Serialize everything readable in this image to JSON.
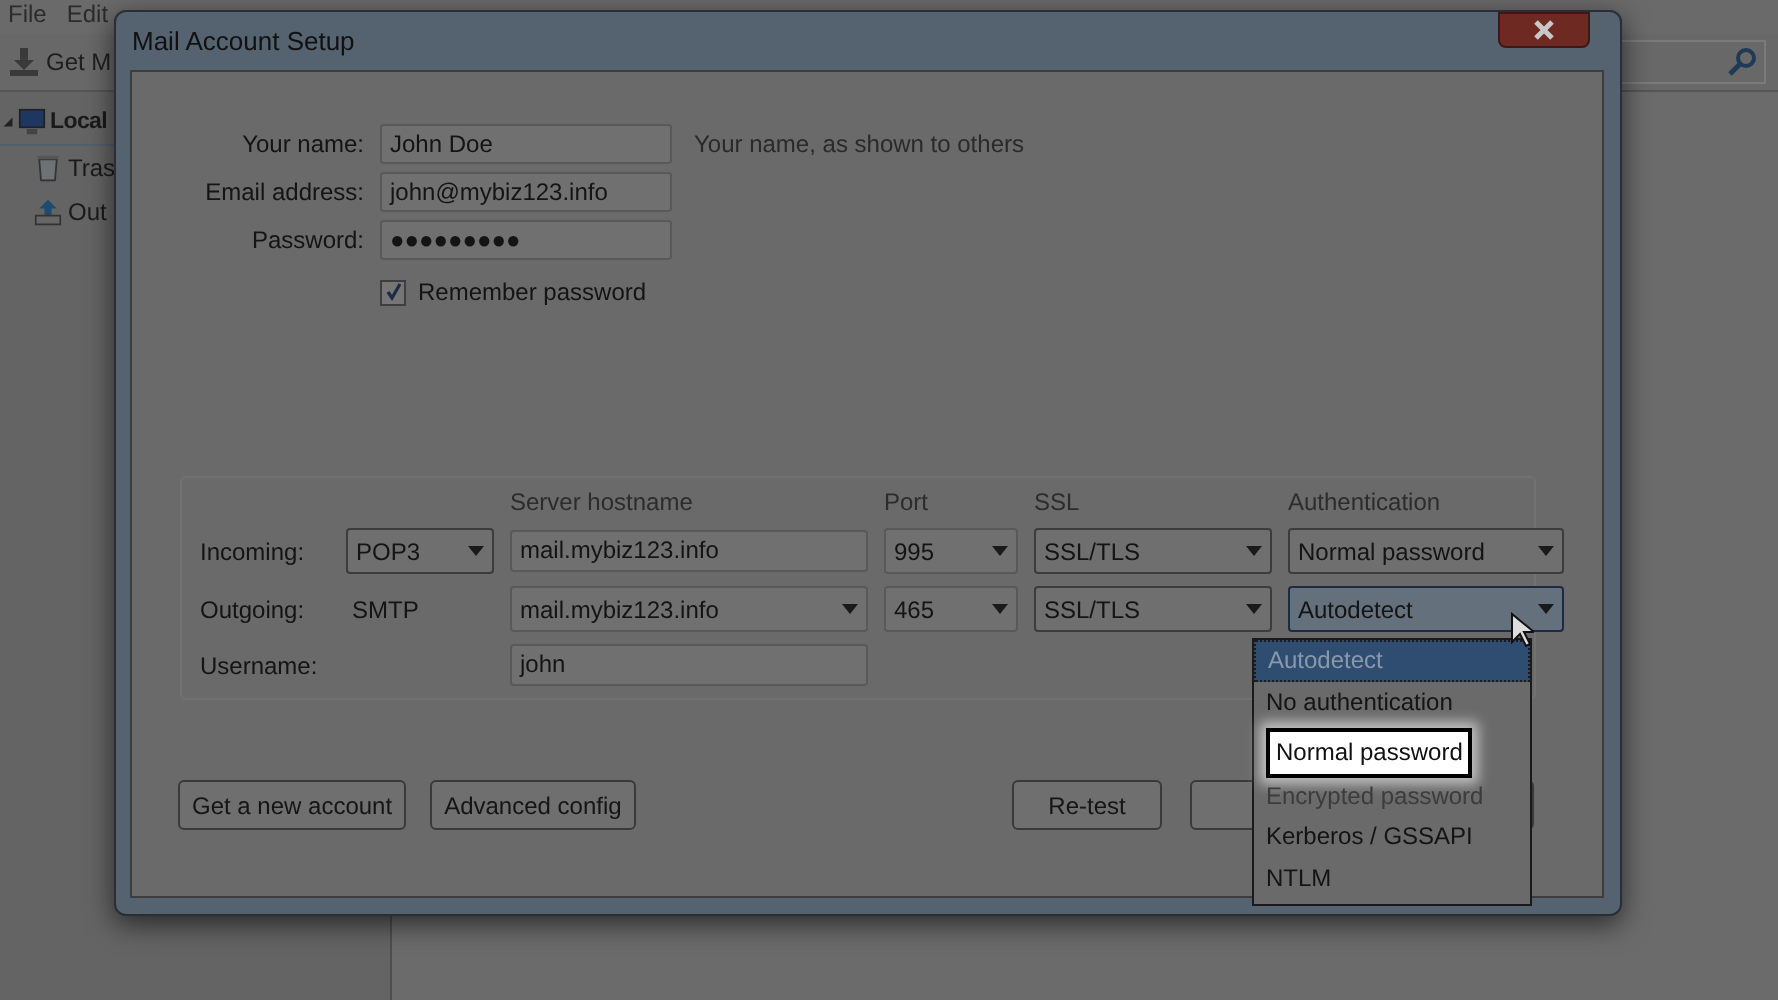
{
  "background_app": {
    "menu": [
      "File",
      "Edit"
    ],
    "toolbar_button": "Get M",
    "folders": [
      {
        "label": "Local",
        "kind": "computer",
        "expanded": true,
        "children": [
          {
            "label": "Tras",
            "kind": "trash"
          },
          {
            "label": "Out",
            "kind": "outbox"
          }
        ]
      }
    ]
  },
  "dialog": {
    "title": "Mail Account Setup",
    "fields": [
      {
        "label": "Your name:",
        "value": "John Doe",
        "hint": "Your name, as shown to others"
      },
      {
        "label": "Email address:",
        "value": "john@mybiz123.info"
      },
      {
        "label": "Password:",
        "value": "●●●●●●●●●"
      }
    ],
    "remember_password": {
      "label": "Remember password",
      "checked": true
    },
    "server": {
      "columns": [
        "Server hostname",
        "Port",
        "SSL",
        "Authentication"
      ],
      "rows": [
        {
          "kind": "incoming",
          "label": "Incoming:",
          "protocol": "POP3",
          "hostname": "mail.mybiz123.info",
          "port": "995",
          "ssl": "SSL/TLS",
          "auth": "Normal password",
          "focused": false
        },
        {
          "kind": "outgoing",
          "label": "Outgoing:",
          "protocol": "SMTP",
          "hostname": "mail.mybiz123.info",
          "port": "465",
          "ssl": "SSL/TLS",
          "auth": "Autodetect",
          "focused": true
        }
      ],
      "username": {
        "label": "Username:",
        "value": "john"
      }
    },
    "buttons": [
      "Get a new account",
      "Advanced config",
      "Re-test"
    ],
    "auth_menu": [
      {
        "label": "Autodetect",
        "selected": true,
        "disabled": false,
        "highlighted": false
      },
      {
        "label": "No authentication",
        "selected": false,
        "disabled": false,
        "highlighted": false
      },
      {
        "label": "Normal password",
        "selected": false,
        "disabled": false,
        "highlighted": true
      },
      {
        "label": "Encrypted password",
        "selected": false,
        "disabled": true,
        "highlighted": false
      },
      {
        "label": "Kerberos / GSSAPI",
        "selected": false,
        "disabled": false,
        "highlighted": false
      },
      {
        "label": "NTLM",
        "selected": false,
        "disabled": false,
        "highlighted": false
      }
    ]
  }
}
